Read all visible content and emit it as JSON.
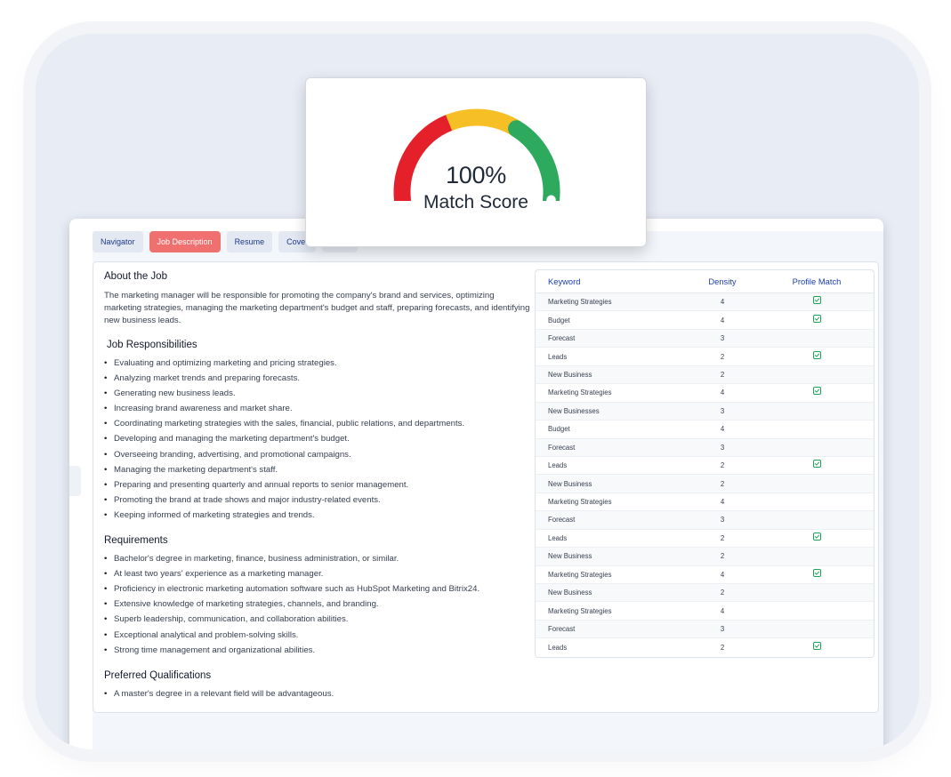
{
  "tabs": [
    "Navigator",
    "Job Description",
    "Resume",
    "Cover"
  ],
  "score": {
    "value": "100%",
    "label": "Match Score",
    "percent": 100,
    "colors": {
      "red": "#e4202a",
      "yellow": "#f6bf26",
      "green": "#2eaa5e"
    }
  },
  "job": {
    "about_title": "About the Job",
    "about_text": "The marketing manager will be responsible for promoting the company's brand and services, optimizing marketing strategies, managing the marketing department's budget and staff, preparing forecasts, and identifying new business leads.",
    "responsibilities_title": "Job Responsibilities",
    "responsibilities": [
      "Evaluating and optimizing marketing and pricing strategies.",
      "Analyzing market trends and preparing forecasts.",
      "Generating new business leads.",
      "Increasing brand awareness and market share.",
      "Coordinating marketing strategies with the sales, financial, public relations, and departments.",
      "Developing and managing the marketing department's budget.",
      "Overseeing branding, advertising, and promotional campaigns.",
      "Managing the marketing department's staff.",
      "Preparing and presenting quarterly and annual reports to senior management.",
      "Promoting the brand at trade shows and major industry-related events.",
      "Keeping informed of marketing strategies and trends."
    ],
    "requirements_title": "Requirements",
    "requirements": [
      "Bachelor's degree in marketing, finance, business administration, or similar.",
      "At least two years' experience as a marketing manager.",
      "Proficiency in electronic marketing automation software such as HubSpot Marketing and Bitrix24.",
      "Extensive knowledge of marketing strategies, channels, and branding.",
      "Superb leadership, communication, and collaboration abilities.",
      "Exceptional analytical and problem-solving skills.",
      "Strong time management and organizational abilities."
    ],
    "preferred_title": "Preferred Qualifications",
    "preferred": [
      "A master's degree in a relevant field will be advantageous."
    ]
  },
  "keywords": {
    "headers": [
      "Keyword",
      "Density",
      "Profile Match"
    ],
    "rows": [
      {
        "keyword": "Marketing Strategies",
        "density": "4",
        "match": true
      },
      {
        "keyword": "Budget",
        "density": "4",
        "match": true
      },
      {
        "keyword": "Forecast",
        "density": "3",
        "match": false
      },
      {
        "keyword": "Leads",
        "density": "2",
        "match": true
      },
      {
        "keyword": "New Business",
        "density": "2",
        "match": false
      },
      {
        "keyword": "Marketing Strategies",
        "density": "4",
        "match": true
      },
      {
        "keyword": "New Businesses",
        "density": "3",
        "match": false
      },
      {
        "keyword": "Budget",
        "density": "4",
        "match": false
      },
      {
        "keyword": "Forecast",
        "density": "3",
        "match": false
      },
      {
        "keyword": "Leads",
        "density": "2",
        "match": true
      },
      {
        "keyword": "New Business",
        "density": "2",
        "match": false
      },
      {
        "keyword": "Marketing Strategies",
        "density": "4",
        "match": false
      },
      {
        "keyword": "Forecast",
        "density": "3",
        "match": false
      },
      {
        "keyword": "Leads",
        "density": "2",
        "match": true
      },
      {
        "keyword": "New Business",
        "density": "2",
        "match": false
      },
      {
        "keyword": "Marketing Strategies",
        "density": "4",
        "match": true
      },
      {
        "keyword": "New Business",
        "density": "2",
        "match": false
      },
      {
        "keyword": "Marketing Strategies",
        "density": "4",
        "match": false
      },
      {
        "keyword": "Forecast",
        "density": "3",
        "match": false
      },
      {
        "keyword": "Leads",
        "density": "2",
        "match": true
      }
    ]
  }
}
